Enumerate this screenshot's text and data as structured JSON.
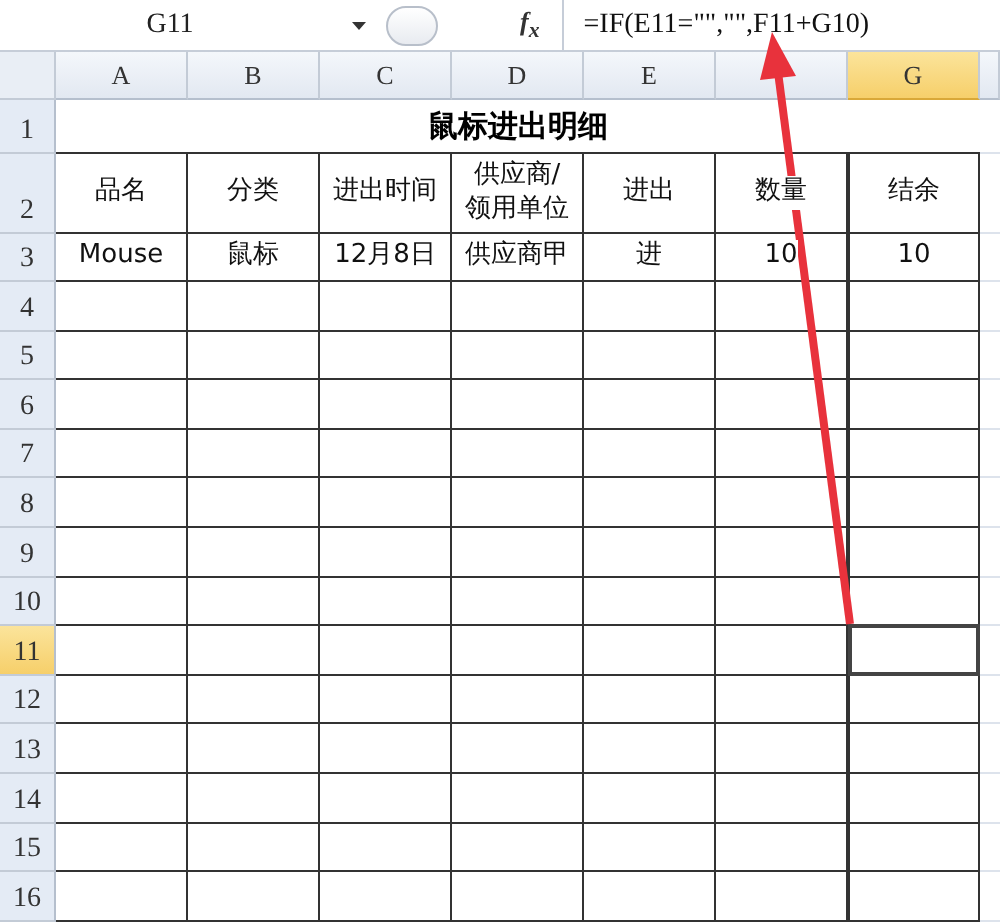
{
  "formula_bar": {
    "name_box": "G11",
    "function_label": "f$_{x}$",
    "formula": "=IF(E11=\"\",\"\",F11+G10)"
  },
  "columns": [
    {
      "label": "A",
      "selected": false
    },
    {
      "label": "B",
      "selected": false
    },
    {
      "label": "C",
      "selected": false
    },
    {
      "label": "D",
      "selected": false
    },
    {
      "label": "E",
      "selected": false
    },
    {
      "selected": false
    },
    {
      "label": "G",
      "selected": true
    }
  ],
  "title": "鼠标进出明细",
  "header_cells": [
    "品名",
    "分类",
    "进出时间",
    "供应商/\n领用单位",
    "进出",
    "数量",
    "结余"
  ],
  "data_rows": [
    [
      "Mouse",
      "鼠标",
      "12月8日",
      "供应商甲",
      "进",
      "10",
      "10"
    ]
  ],
  "rows": [
    {
      "number": "1",
      "selected": false
    },
    {
      "number": "2",
      "selected": false
    },
    {
      "number": "3",
      "selected": false
    },
    {
      "number": "4",
      "selected": false
    },
    {
      "number": "5",
      "selected": false
    },
    {
      "number": "6",
      "selected": false
    },
    {
      "number": "7",
      "selected": false
    },
    {
      "number": "8",
      "selected": false
    },
    {
      "number": "9",
      "selected": false
    },
    {
      "number": "10",
      "selected": false
    },
    {
      "number": "11",
      "selected": true
    },
    {
      "number": "12",
      "selected": false
    },
    {
      "number": "13",
      "selected": false
    },
    {
      "number": "14",
      "selected": false
    },
    {
      "number": "15",
      "selected": false
    },
    {
      "number": "16",
      "selected": false
    }
  ]
}
